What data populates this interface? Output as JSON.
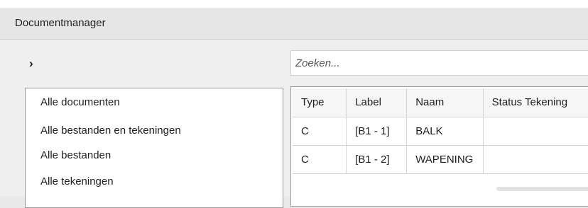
{
  "window": {
    "title": "Documentmanager"
  },
  "toolbar": {
    "expand_icon": "chevron-right-icon",
    "expand_glyph": "›"
  },
  "search": {
    "placeholder": "Zoeken...",
    "value": ""
  },
  "nav": {
    "items": [
      {
        "label": "Alle documenten"
      },
      {
        "label": "Alle bestanden en tekeningen"
      },
      {
        "label": "Alle bestanden"
      },
      {
        "label": "Alle tekeningen"
      }
    ]
  },
  "table": {
    "columns": [
      "Type",
      "Label",
      "Naam",
      "Status Tekening"
    ],
    "rows": [
      {
        "type": "C",
        "label": "[B1 - 1]",
        "naam": "BALK",
        "status": ""
      },
      {
        "type": "C",
        "label": "[B1 - 2]",
        "naam": "WAPENING",
        "status": ""
      }
    ]
  },
  "colors": {
    "titlebar_bg": "#e6e6e6",
    "panel_bg": "#efefef",
    "border": "#9a9a9a"
  }
}
